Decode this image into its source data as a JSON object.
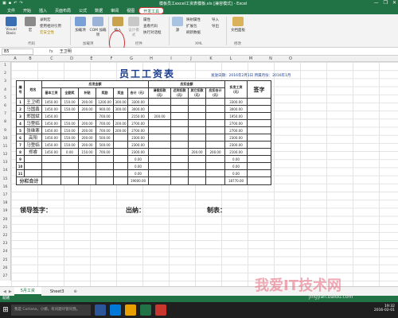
{
  "window": {
    "title": "模板员工excel工资表模板.xls [兼容模式] - Excel",
    "min": "—",
    "max": "❐",
    "close": "✕"
  },
  "ribbon_tabs": [
    "文件",
    "开始",
    "插入",
    "页面布局",
    "公式",
    "数据",
    "审阅",
    "视图",
    "开发工具"
  ],
  "ribbon": {
    "code_group": "代码",
    "addins_group": "加载项",
    "controls_group": "控件",
    "xml_group": "XML",
    "modify_group": "修改",
    "visual_basic": "Visual Basic",
    "macros": "宏",
    "record_macro": "录制宏",
    "relative_ref": "使用相对引用",
    "macro_security": "宏安全性",
    "addins": "加载项",
    "com_addins": "COM 加载项",
    "insert": "插入",
    "design_mode": "设计模式",
    "properties": "属性",
    "view_code": "查看代码",
    "run_dialog": "执行对话框",
    "source": "源",
    "map_props": "映射属性",
    "expansion_packs": "扩展包",
    "refresh_data": "刷新数据",
    "import": "导入",
    "export": "导出",
    "doc_panel": "文档面板"
  },
  "formula_bar": {
    "name_box": "B5",
    "fx": "fx",
    "value": "王卫明"
  },
  "columns": [
    "A",
    "B",
    "C",
    "D",
    "E",
    "F",
    "G",
    "H",
    "I",
    "J",
    "K",
    "L",
    "M",
    "N",
    "O"
  ],
  "rows": [
    "1",
    "2",
    "3",
    "4",
    "5",
    "6",
    "7",
    "8",
    "9",
    "10",
    "11",
    "12",
    "13",
    "14",
    "15",
    "16",
    "17",
    "18",
    "19",
    "20",
    "21",
    "22",
    "23",
    "24",
    "25",
    "26",
    "27"
  ],
  "sheet": {
    "title": "员工工资表",
    "date_line": "发放日期：2016年2月1日   所属月份：2016年1月",
    "headers": {
      "num": "编号",
      "name": "姓名",
      "payable": "应发金额",
      "deduct": "应扣金额",
      "base": "基本工资",
      "allowance": "全勤奖",
      "subsidy": "补贴",
      "bonus": "奖励",
      "award": "奖金",
      "total": "合计（元）",
      "leave": "请假扣款（元）",
      "late": "迟到扣款（元）",
      "other": "其它扣款（元）",
      "deduct_total": "应扣合计（元）",
      "actual": "实发工资（元）",
      "sign": "签字"
    },
    "data_rows": [
      {
        "n": "1",
        "name": "王卫明",
        "v": [
          "1450.00",
          "150.00",
          "200.00",
          "1200.00",
          "300.00",
          "3300.00",
          "",
          "",
          "",
          "",
          "3300.00"
        ]
      },
      {
        "n": "2",
        "name": "马国鑫",
        "v": [
          "1450.00",
          "150.00",
          "200.00",
          "900.00",
          "300.00",
          "3000.00",
          "",
          "",
          "",
          "",
          "3000.00"
        ]
      },
      {
        "n": "3",
        "name": "郑国斌",
        "v": [
          "1450.00",
          "",
          "",
          "700.00",
          "",
          "2150.00",
          "200.00",
          "",
          "",
          "",
          "1950.00"
        ]
      },
      {
        "n": "4",
        "name": "马登临",
        "v": [
          "1450.00",
          "150.00",
          "200.00",
          "700.00",
          "200.00",
          "2700.00",
          "",
          "",
          "",
          "",
          "2700.00"
        ]
      },
      {
        "n": "5",
        "name": "张继寒",
        "v": [
          "1450.00",
          "150.00",
          "200.00",
          "700.00",
          "200.00",
          "2700.00",
          "",
          "",
          "",
          "",
          "2700.00"
        ]
      },
      {
        "n": "6",
        "name": "高阳",
        "v": [
          "1450.00",
          "150.00",
          "200.00",
          "500.00",
          "",
          "2300.00",
          "",
          "",
          "",
          "",
          "2300.00"
        ]
      },
      {
        "n": "7",
        "name": "马登临",
        "v": [
          "1450.00",
          "150.00",
          "200.00",
          "500.00",
          "",
          "2300.00",
          "",
          "",
          "",
          "",
          "2300.00"
        ]
      },
      {
        "n": "8",
        "name": "郑睿",
        "v": [
          "1450.00",
          "0.00",
          "150.00",
          "700.00",
          "",
          "2300.00",
          "",
          "",
          "200.00",
          "200.00",
          "2100.00"
        ]
      },
      {
        "n": "9",
        "name": "",
        "v": [
          "",
          "",
          "",
          "",
          "",
          "0.00",
          "",
          "",
          "",
          "",
          "0.00"
        ]
      },
      {
        "n": "10",
        "name": "",
        "v": [
          "",
          "",
          "",
          "",
          "",
          "0.00",
          "",
          "",
          "",
          "",
          "0.00"
        ]
      },
      {
        "n": "11",
        "name": "",
        "v": [
          "",
          "",
          "",
          "",
          "",
          "0.00",
          "",
          "",
          "",
          "",
          "0.00"
        ]
      }
    ],
    "subtotal_label": "分栏合计",
    "subtotal_total": "19000.00",
    "subtotal_actual": "18770.00",
    "footer_leader": "领导签字：",
    "footer_cashier": "出纳：",
    "footer_maker": "制表："
  },
  "sheet_tabs": [
    "5月工资",
    "Sheet3"
  ],
  "status": "就绪",
  "taskbar": {
    "search_placeholder": "我是 Cortana，小娜。有问题尽管问我。",
    "time": "19:32",
    "date": "2016-02-01"
  },
  "watermark": "我爱IT技术网",
  "watermark_url": "jingyan.baidu.com",
  "colors": {
    "excel_green": "#217346",
    "highlight_red": "#cc3333",
    "title_blue": "#1a3d8f"
  }
}
